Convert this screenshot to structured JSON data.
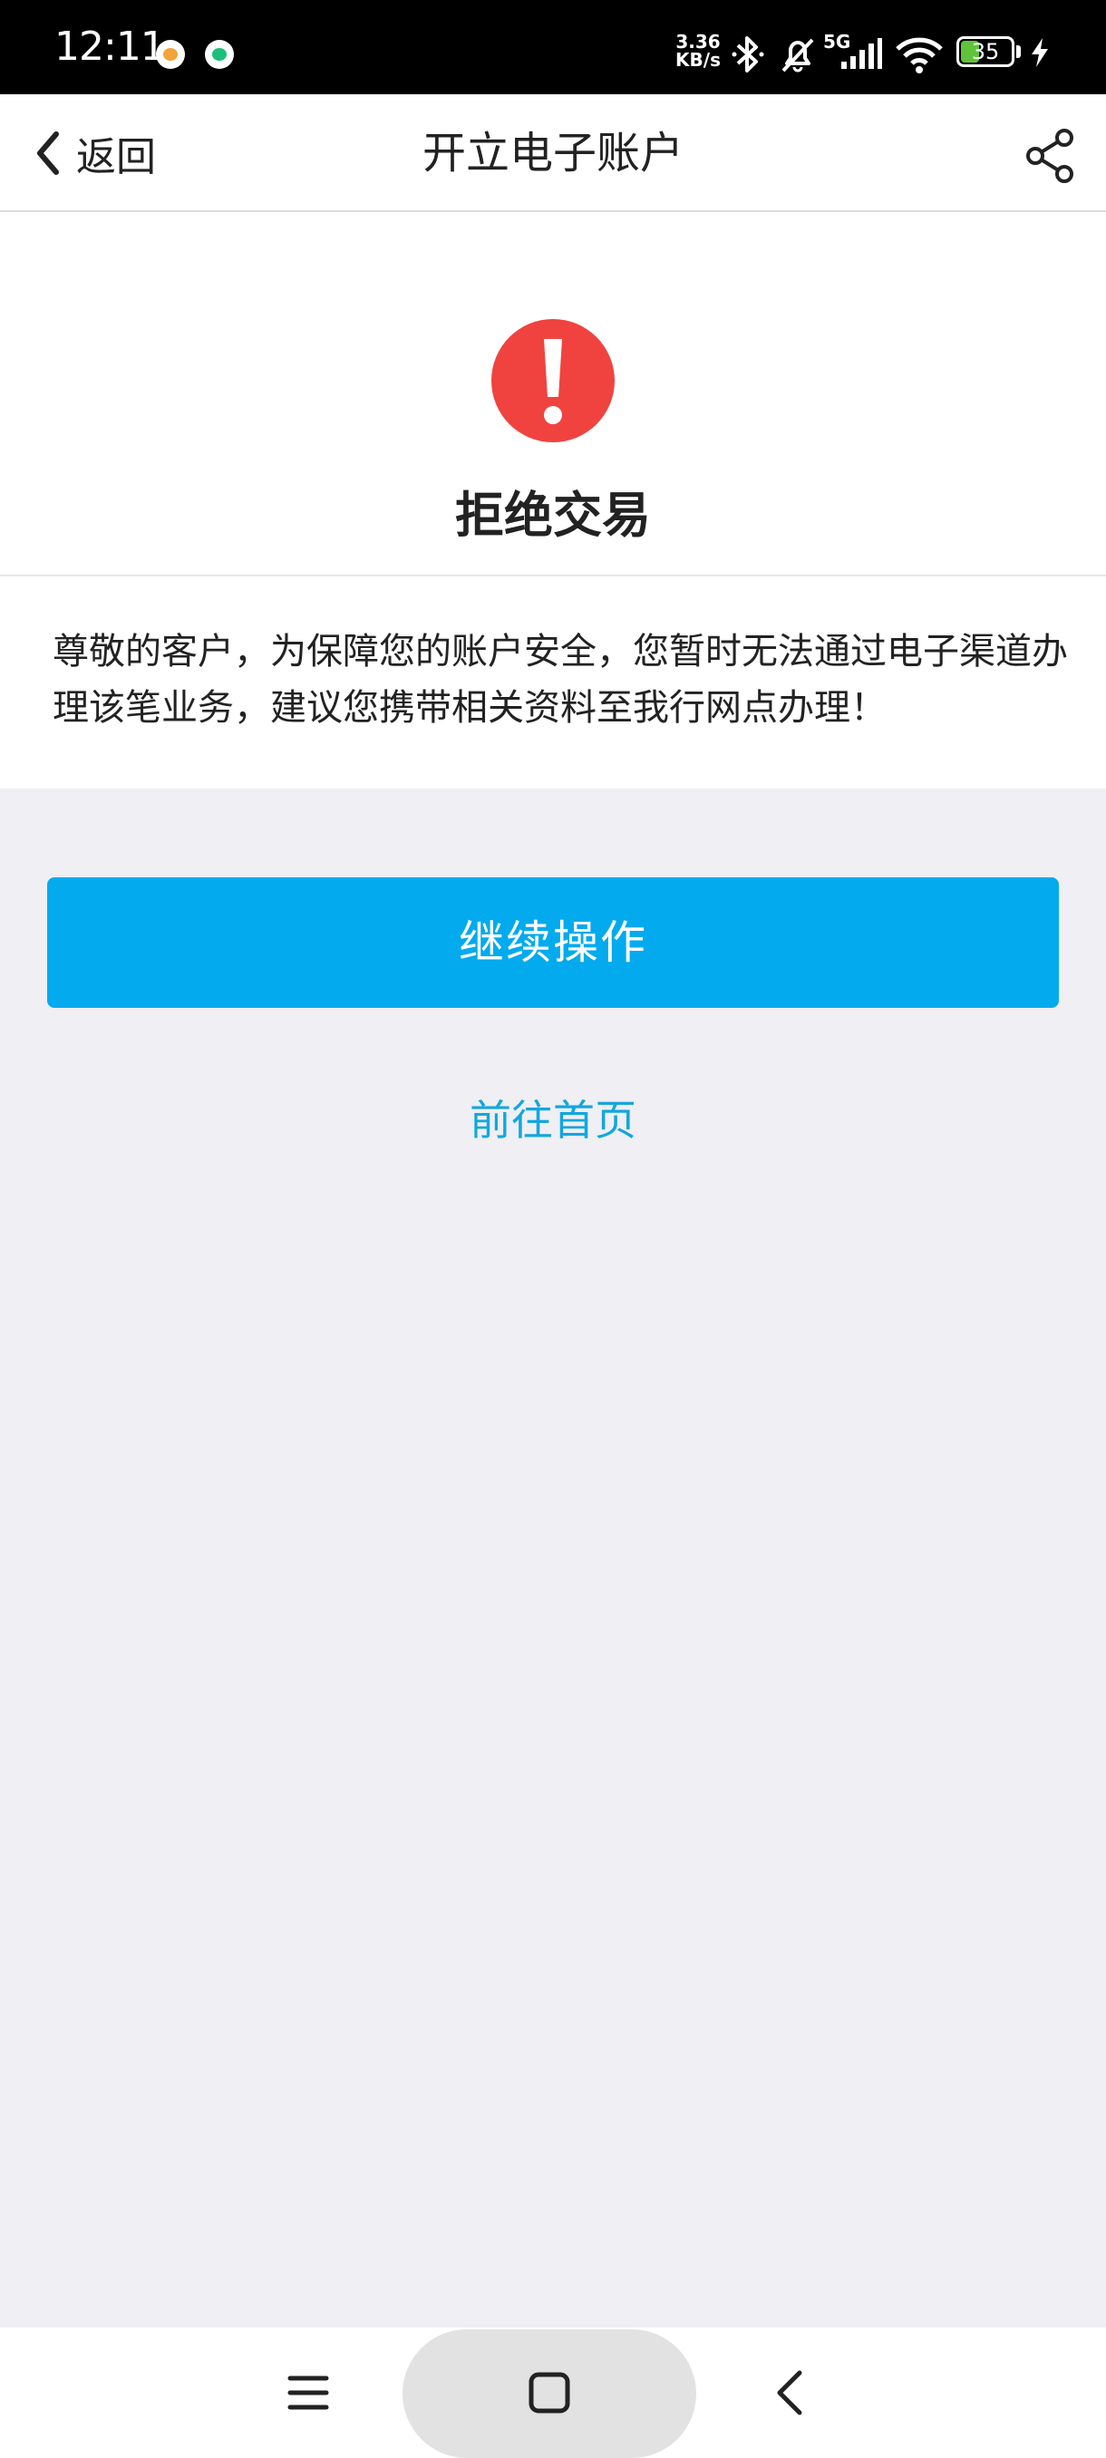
{
  "status_bar": {
    "time": "12:11",
    "net_speed_value": "3.36",
    "net_speed_unit": "KB/s",
    "network_type": "5G",
    "battery_level": "35",
    "battery_fraction": 0.35
  },
  "nav": {
    "back_label": "返回",
    "title": "开立电子账户"
  },
  "result": {
    "title": "拒绝交易",
    "message": "尊敬的客户，为保障您的账户安全，您暂时无法通过电子渠道办理该笔业务，建议您携带相关资料至我行网点办理！"
  },
  "actions": {
    "continue_label": "继续操作",
    "home_label": "前往首页"
  },
  "colors": {
    "primary": "#03aaee",
    "link": "#13a7dd",
    "error": "#f0433f",
    "background": "#efeff4"
  },
  "icons": {
    "back": "chevron-left-icon",
    "share": "share-icon",
    "error": "exclamation-icon",
    "menu": "menu-icon",
    "home": "home-icon",
    "sys_back": "back-icon"
  }
}
